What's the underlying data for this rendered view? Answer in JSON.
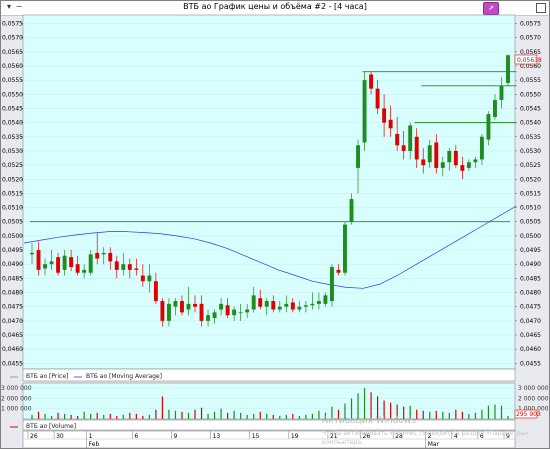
{
  "window": {
    "title": "ВТБ ао График цены и объёма #2 - [4 часа]"
  },
  "price_axis": {
    "ticks": [
      "0,0575",
      "0,0570",
      "0,0565",
      "0,0560",
      "0,0555",
      "0,0550",
      "0,0545",
      "0,0540",
      "0,0535",
      "0,0530",
      "0,0525",
      "0,0520",
      "0,0515",
      "0,0510",
      "0,0505",
      "0,0500",
      "0,0495",
      "0,0490",
      "0,0485",
      "0,0480",
      "0,0475",
      "0,0470",
      "0,0465",
      "0,0460",
      "0,0455"
    ],
    "current_price_label": "0,05638"
  },
  "legend": {
    "price_label": "ВТБ ао [Price]",
    "ma_label": "ВТБ ао [Moving Average]",
    "volume_label": "ВТБ ао [Volume]"
  },
  "volume_axis": {
    "ticks": [
      "3 000 000",
      "2 000 000",
      "1 000 000"
    ],
    "current_volume_label": "295 903"
  },
  "time_axis": {
    "day_labels": [
      "26",
      "30",
      "1",
      "6",
      "9",
      "13",
      "15",
      "19",
      "21",
      "26",
      "28",
      "2",
      "4",
      "6",
      "9"
    ],
    "month_labels": [
      "Feb",
      "Mar"
    ]
  },
  "watermark": {
    "line1": "Активация Windows",
    "line2": "Чтобы активировать Windows, перейдите в раздел «Параметры»",
    "line3": "компьютера."
  },
  "colors": {
    "background": "#d8fefe",
    "up": "#1e8c1e",
    "down": "#e00000",
    "ma": "#2b39e6",
    "levels": "#1f8a1f"
  },
  "chart_data": [
    {
      "type": "candlestick",
      "title": "ВТБ ао График цены и объёма #2 - [4 часа]",
      "timeframe": "4 часа",
      "series_name": "ВТБ ао [Price]",
      "ylim": [
        0.0453,
        0.0578
      ],
      "candles": [
        {
          "o": 0.04935,
          "h": 0.04975,
          "l": 0.049,
          "c": 0.0494
        },
        {
          "o": 0.0495,
          "h": 0.0498,
          "l": 0.0486,
          "c": 0.0488
        },
        {
          "o": 0.04885,
          "h": 0.0492,
          "l": 0.0486,
          "c": 0.049
        },
        {
          "o": 0.049,
          "h": 0.0495,
          "l": 0.0488,
          "c": 0.0491
        },
        {
          "o": 0.04925,
          "h": 0.0494,
          "l": 0.0486,
          "c": 0.0487
        },
        {
          "o": 0.0488,
          "h": 0.0495,
          "l": 0.0486,
          "c": 0.0493
        },
        {
          "o": 0.04925,
          "h": 0.0495,
          "l": 0.04875,
          "c": 0.0489
        },
        {
          "o": 0.049,
          "h": 0.0493,
          "l": 0.0486,
          "c": 0.0487
        },
        {
          "o": 0.0487,
          "h": 0.049,
          "l": 0.0485,
          "c": 0.0488
        },
        {
          "o": 0.0487,
          "h": 0.0495,
          "l": 0.0486,
          "c": 0.04935
        },
        {
          "o": 0.0494,
          "h": 0.0501,
          "l": 0.049,
          "c": 0.0492
        },
        {
          "o": 0.04935,
          "h": 0.0496,
          "l": 0.049,
          "c": 0.0494
        },
        {
          "o": 0.0494,
          "h": 0.0496,
          "l": 0.0488,
          "c": 0.0491
        },
        {
          "o": 0.0491,
          "h": 0.0493,
          "l": 0.0485,
          "c": 0.0488
        },
        {
          "o": 0.0488,
          "h": 0.0494,
          "l": 0.0486,
          "c": 0.049
        },
        {
          "o": 0.049,
          "h": 0.0492,
          "l": 0.0485,
          "c": 0.0488
        },
        {
          "o": 0.04885,
          "h": 0.0492,
          "l": 0.0486,
          "c": 0.0488
        },
        {
          "o": 0.0486,
          "h": 0.049,
          "l": 0.0482,
          "c": 0.0484
        },
        {
          "o": 0.0484,
          "h": 0.049,
          "l": 0.048,
          "c": 0.0486
        },
        {
          "o": 0.0484,
          "h": 0.0487,
          "l": 0.0476,
          "c": 0.0477
        },
        {
          "o": 0.0477,
          "h": 0.0478,
          "l": 0.0468,
          "c": 0.047
        },
        {
          "o": 0.047,
          "h": 0.0478,
          "l": 0.0468,
          "c": 0.0476
        },
        {
          "o": 0.0475,
          "h": 0.0478,
          "l": 0.0472,
          "c": 0.0477
        },
        {
          "o": 0.0477,
          "h": 0.0479,
          "l": 0.0472,
          "c": 0.0473
        },
        {
          "o": 0.0474,
          "h": 0.0482,
          "l": 0.0472,
          "c": 0.0476
        },
        {
          "o": 0.0476,
          "h": 0.0479,
          "l": 0.0473,
          "c": 0.0475
        },
        {
          "o": 0.0476,
          "h": 0.0479,
          "l": 0.0468,
          "c": 0.047
        },
        {
          "o": 0.047,
          "h": 0.0474,
          "l": 0.0468,
          "c": 0.0472
        },
        {
          "o": 0.0471,
          "h": 0.0474,
          "l": 0.0469,
          "c": 0.0473
        },
        {
          "o": 0.0474,
          "h": 0.0478,
          "l": 0.0472,
          "c": 0.0476
        },
        {
          "o": 0.04755,
          "h": 0.0478,
          "l": 0.0471,
          "c": 0.0472
        },
        {
          "o": 0.0472,
          "h": 0.0475,
          "l": 0.047,
          "c": 0.0474
        },
        {
          "o": 0.0473,
          "h": 0.0476,
          "l": 0.047,
          "c": 0.0473
        },
        {
          "o": 0.0473,
          "h": 0.0476,
          "l": 0.0471,
          "c": 0.0474
        },
        {
          "o": 0.0474,
          "h": 0.0482,
          "l": 0.0473,
          "c": 0.0479
        },
        {
          "o": 0.0478,
          "h": 0.0481,
          "l": 0.0474,
          "c": 0.0475
        },
        {
          "o": 0.0475,
          "h": 0.0478,
          "l": 0.0472,
          "c": 0.0477
        },
        {
          "o": 0.0477,
          "h": 0.0479,
          "l": 0.0473,
          "c": 0.0474
        },
        {
          "o": 0.0474,
          "h": 0.0477,
          "l": 0.0473,
          "c": 0.0475
        },
        {
          "o": 0.0475,
          "h": 0.0479,
          "l": 0.0473,
          "c": 0.0476
        },
        {
          "o": 0.04765,
          "h": 0.0478,
          "l": 0.0473,
          "c": 0.0474
        },
        {
          "o": 0.0474,
          "h": 0.0477,
          "l": 0.0473,
          "c": 0.0475
        },
        {
          "o": 0.0475,
          "h": 0.0477,
          "l": 0.0473,
          "c": 0.04755
        },
        {
          "o": 0.04755,
          "h": 0.048,
          "l": 0.0474,
          "c": 0.0476
        },
        {
          "o": 0.0476,
          "h": 0.048,
          "l": 0.0474,
          "c": 0.0477
        },
        {
          "o": 0.0476,
          "h": 0.048,
          "l": 0.0475,
          "c": 0.0479
        },
        {
          "o": 0.0477,
          "h": 0.049,
          "l": 0.0475,
          "c": 0.0489
        },
        {
          "o": 0.0488,
          "h": 0.049,
          "l": 0.0486,
          "c": 0.0487
        },
        {
          "o": 0.0487,
          "h": 0.0505,
          "l": 0.0486,
          "c": 0.0504
        },
        {
          "o": 0.0505,
          "h": 0.0515,
          "l": 0.0504,
          "c": 0.0513
        },
        {
          "o": 0.0524,
          "h": 0.0534,
          "l": 0.0515,
          "c": 0.0532
        },
        {
          "o": 0.0533,
          "h": 0.0558,
          "l": 0.053,
          "c": 0.0555
        },
        {
          "o": 0.0557,
          "h": 0.0558,
          "l": 0.055,
          "c": 0.0552
        },
        {
          "o": 0.0552,
          "h": 0.0555,
          "l": 0.0543,
          "c": 0.0545
        },
        {
          "o": 0.0545,
          "h": 0.055,
          "l": 0.0535,
          "c": 0.054
        },
        {
          "o": 0.0541,
          "h": 0.0546,
          "l": 0.0535,
          "c": 0.0538
        },
        {
          "o": 0.0536,
          "h": 0.0542,
          "l": 0.053,
          "c": 0.0532
        },
        {
          "o": 0.0532,
          "h": 0.0537,
          "l": 0.0527,
          "c": 0.053
        },
        {
          "o": 0.053,
          "h": 0.054,
          "l": 0.0527,
          "c": 0.0539
        },
        {
          "o": 0.0535,
          "h": 0.0538,
          "l": 0.0524,
          "c": 0.0527
        },
        {
          "o": 0.0527,
          "h": 0.0531,
          "l": 0.0522,
          "c": 0.0525
        },
        {
          "o": 0.0526,
          "h": 0.0534,
          "l": 0.0524,
          "c": 0.0532
        },
        {
          "o": 0.0533,
          "h": 0.0536,
          "l": 0.0522,
          "c": 0.0524
        },
        {
          "o": 0.0524,
          "h": 0.0528,
          "l": 0.0521,
          "c": 0.0526
        },
        {
          "o": 0.0526,
          "h": 0.0531,
          "l": 0.0523,
          "c": 0.053
        },
        {
          "o": 0.053,
          "h": 0.0532,
          "l": 0.0524,
          "c": 0.0525
        },
        {
          "o": 0.0525,
          "h": 0.0528,
          "l": 0.052,
          "c": 0.0523
        },
        {
          "o": 0.0524,
          "h": 0.0527,
          "l": 0.0523,
          "c": 0.0526
        },
        {
          "o": 0.0526,
          "h": 0.0528,
          "l": 0.0524,
          "c": 0.0527
        },
        {
          "o": 0.0527,
          "h": 0.0536,
          "l": 0.0525,
          "c": 0.0535
        },
        {
          "o": 0.0534,
          "h": 0.0544,
          "l": 0.0532,
          "c": 0.0543
        },
        {
          "o": 0.0542,
          "h": 0.055,
          "l": 0.0541,
          "c": 0.0548
        },
        {
          "o": 0.0548,
          "h": 0.0556,
          "l": 0.0545,
          "c": 0.0553
        },
        {
          "o": 0.0554,
          "h": 0.0564,
          "l": 0.0553,
          "c": 0.05638
        }
      ],
      "moving_average": [
        0.04975,
        0.04985,
        0.04995,
        0.05003,
        0.0501,
        0.05015,
        0.05015,
        0.05012,
        0.05008,
        0.05,
        0.0499,
        0.04975,
        0.04955,
        0.0493,
        0.04905,
        0.0488,
        0.0486,
        0.0484,
        0.04828,
        0.04818,
        0.04815,
        0.0483,
        0.0486,
        0.04895,
        0.0493,
        0.04965,
        0.05,
        0.05035,
        0.0507,
        0.05105
      ],
      "levels": [
        {
          "price": 0.0505,
          "from": 0,
          "to": 73
        },
        {
          "price": 0.0558,
          "from": 51,
          "to": 74
        },
        {
          "price": 0.0553,
          "from": 60,
          "to": 74
        },
        {
          "price": 0.054,
          "from": 59,
          "to": 74
        }
      ]
    },
    {
      "type": "bar",
      "series_name": "ВТБ ао [Volume]",
      "ylim": [
        0,
        3500000
      ],
      "values": [
        400000,
        700000,
        500000,
        300000,
        600000,
        500000,
        400000,
        300000,
        700000,
        500000,
        600000,
        400000,
        500000,
        300000,
        400000,
        600000,
        500000,
        300000,
        400000,
        900000,
        2200000,
        900000,
        800000,
        700000,
        600000,
        900000,
        1100000,
        500000,
        700000,
        1000000,
        600000,
        800000,
        600000,
        400000,
        500000,
        700000,
        500000,
        400000,
        300000,
        400000,
        500000,
        300000,
        400000,
        500000,
        800000,
        600000,
        1200000,
        900000,
        1500000,
        2000000,
        2500000,
        3000000,
        2600000,
        2200000,
        1800000,
        1600000,
        1400000,
        1200000,
        1300000,
        900000,
        800000,
        700000,
        800000,
        700000,
        600000,
        900000,
        700000,
        500000,
        600000,
        900000,
        1300000,
        1400000,
        1300000,
        295903
      ]
    }
  ]
}
